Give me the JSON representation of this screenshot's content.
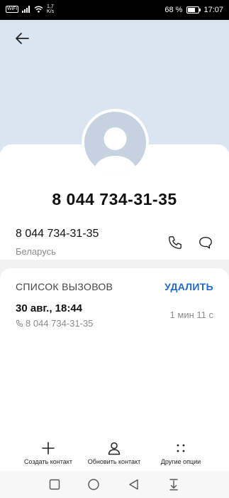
{
  "status_bar": {
    "speed_value": "1,7",
    "speed_unit": "K/s",
    "battery": "68 %",
    "time": "17:07"
  },
  "contact": {
    "title_number": "8 044 734-31-35",
    "number": "8 044 734-31-35",
    "country": "Беларусь"
  },
  "call_history": {
    "title": "СПИСОК ВЫЗОВОВ",
    "delete_label": "УДАЛИТЬ",
    "entries": [
      {
        "date": "30 авг., 18:44",
        "number": "8 044 734-31-35",
        "duration": "1 мин 11 с"
      }
    ]
  },
  "actions": {
    "create_contact": "Создать контакт",
    "update_contact": "Обновить контакт",
    "more_options": "Другие опции"
  },
  "colors": {
    "header_bg": "#dbe5f1",
    "accent": "#1f68c9"
  }
}
